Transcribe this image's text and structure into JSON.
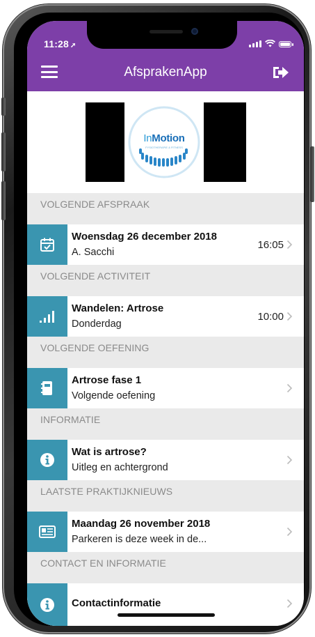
{
  "status_bar": {
    "time": "11:28",
    "location_glyph": "➚"
  },
  "header": {
    "title": "AfsprakenApp",
    "background": "#7d3fa8"
  },
  "logo": {
    "brand_in": "In",
    "brand_motion": "Motion",
    "tagline": "FYSIOTHERAPIE & FITNESS"
  },
  "sections": {
    "appointment": {
      "header": "VOLGENDE AFSPRAAK",
      "title": "Woensdag 26 december 2018",
      "subtitle": "A. Sacchi",
      "time": "16:05"
    },
    "activity": {
      "header": "VOLGENDE ACTIVITEIT",
      "title": "Wandelen: Artrose",
      "subtitle": "Donderdag",
      "time": "10:00"
    },
    "exercise": {
      "header": "VOLGENDE OEFENING",
      "title": "Artrose fase 1",
      "subtitle": "Volgende oefening"
    },
    "information": {
      "header": "INFORMATIE",
      "title": "Wat is artrose?",
      "subtitle": "Uitleg en achtergrond"
    },
    "news": {
      "header": "LAATSTE PRAKTIJKNIEUWS",
      "title": "Maandag 26 november 2018",
      "subtitle": "Parkeren is deze week in de..."
    },
    "contact": {
      "header": "CONTACT EN INFORMATIE",
      "title": "Contactinformatie"
    }
  },
  "icons": {
    "menu": "hamburger-menu-icon",
    "logout": "logout-icon",
    "appointment": "calendar-check-icon",
    "activity": "signal-bars-icon",
    "exercise": "notebook-icon",
    "information": "info-circle-icon",
    "news": "newspaper-icon",
    "contact": "info-circle-icon",
    "chevron": "chevron-right-icon"
  },
  "colors": {
    "accent": "#7d3fa8",
    "icon_tile": "#3a95b0",
    "section_bg": "#eaeaea",
    "section_text": "#8a8a8a"
  }
}
